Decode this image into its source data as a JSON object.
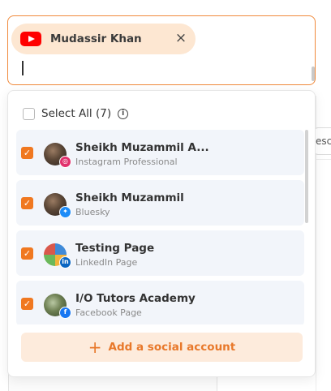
{
  "selector": {
    "chip": {
      "icon": "youtube-icon",
      "label": "Mudassir Khan",
      "close": "×"
    }
  },
  "background": {
    "button_text": "esc"
  },
  "dropdown": {
    "select_all": {
      "label": "Select All",
      "count": "(7)",
      "info": "i"
    },
    "items": [
      {
        "name": "Sheikh Muzammil A...",
        "type": "Instagram Professional",
        "checked": true,
        "platform": "instagram",
        "badge": "◎"
      },
      {
        "name": "Sheikh Muzammil",
        "type": "Bluesky",
        "checked": true,
        "platform": "bluesky",
        "badge": "✦"
      },
      {
        "name": "Testing Page",
        "type": "LinkedIn Page",
        "checked": true,
        "platform": "linkedin",
        "badge": "in"
      },
      {
        "name": "I/O Tutors Academy",
        "type": "Facebook Page",
        "checked": true,
        "platform": "facebook",
        "badge": "f"
      }
    ],
    "check_mark": "✓",
    "add_button": {
      "icon": "plus-icon",
      "plus": "+",
      "label": "Add a social account"
    }
  },
  "colors": {
    "accent": "#f07820",
    "chip_bg": "#fde7d2",
    "item_bg": "#f2f5fa"
  }
}
